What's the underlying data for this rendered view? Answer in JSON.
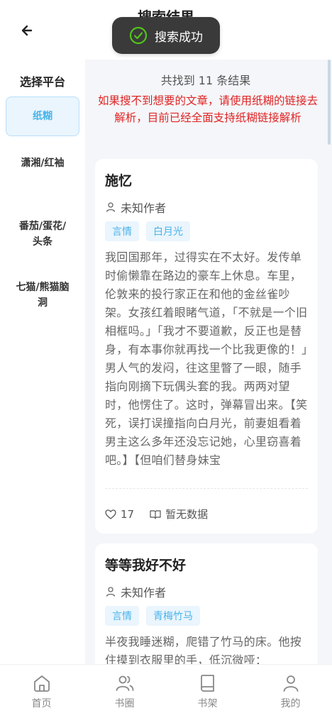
{
  "header": {
    "title": "搜索结果"
  },
  "toast": {
    "text": "搜索成功"
  },
  "sidebar": {
    "title": "选择平台",
    "items": [
      {
        "label": "纸糊"
      },
      {
        "label": "潇湘/红袖"
      },
      {
        "label": "番茄/蛋花/\n头条"
      },
      {
        "label": "七猫/熊猫脑\n洞"
      }
    ]
  },
  "main": {
    "count_text": "共找到 11 条结果",
    "notice": "如果搜不到想要的文章，请使用纸糊的链接去解析，目前已经全面支持纸糊链接解析"
  },
  "results": [
    {
      "title": "施忆",
      "author": "未知作者",
      "tags": [
        "言情",
        "白月光"
      ],
      "desc": "我回国那年，过得实在不太好。发传单时偷懒靠在路边的豪车上休息。车里，伦敦来的投行家正在和他的金丝雀吵架。女孩红着眼睹气道，「不就是一个旧相框吗。」「我才不要道歉，反正也是替身，有本事你就再找一个比我更像的！」男人气的发闷，往这里瞥了一眼，随手指向刚摘下玩偶头套的我。两两对望时，他愣住了。这时，弹幕冒出来。【笑死，误打误撞指向白月光，前妻姐看着男主这么多年还没忘记她，心里窃喜着吧。】【但咱们替身妹宝",
      "likes": "17",
      "reads": "暂无数据"
    },
    {
      "title": "等等我好不好",
      "author": "未知作者",
      "tags": [
        "言情",
        "青梅竹马"
      ],
      "desc": "半夜我睡迷糊，爬错了竹马的床。他按住摸到衣服里的手，低沉微哑："
    }
  ],
  "bottom_nav": [
    {
      "label": "首页",
      "icon": "home-icon"
    },
    {
      "label": "书圈",
      "icon": "users-icon"
    },
    {
      "label": "书架",
      "icon": "book-icon"
    },
    {
      "label": "我的",
      "icon": "user-icon"
    }
  ],
  "colors": {
    "accent": "#49b4ea",
    "notice": "#e02424",
    "toast_check": "#52c41a"
  }
}
